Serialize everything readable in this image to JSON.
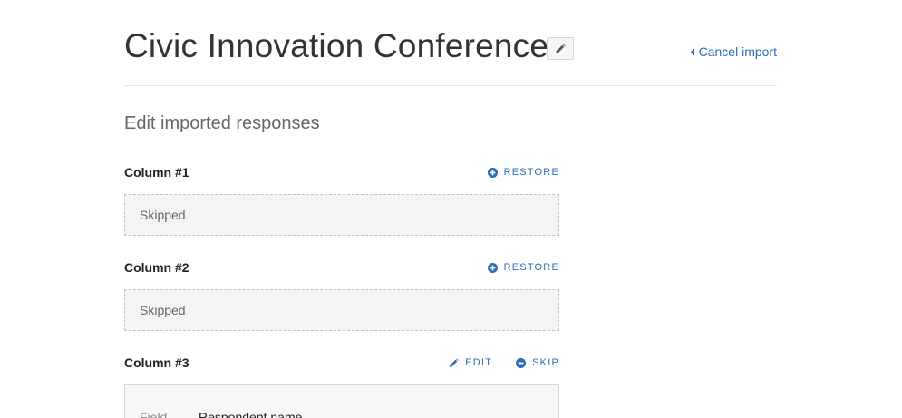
{
  "header": {
    "title": "Civic Innovation Conference",
    "edit_icon": "pencil-icon",
    "cancel_label": "Cancel import",
    "cancel_icon": "caret-left-icon"
  },
  "section": {
    "title": "Edit imported responses"
  },
  "columns": [
    {
      "label": "Column #1",
      "status": "Skipped",
      "actions": [
        {
          "label": "RESTORE",
          "icon": "plus-circle-icon"
        }
      ]
    },
    {
      "label": "Column #2",
      "status": "Skipped",
      "actions": [
        {
          "label": "RESTORE",
          "icon": "plus-circle-icon"
        }
      ]
    },
    {
      "label": "Column #3",
      "actions": [
        {
          "label": "EDIT",
          "icon": "pencil-icon"
        },
        {
          "label": "SKIP",
          "icon": "minus-circle-icon"
        }
      ],
      "field_label": "Field",
      "field_value": "Respondent name"
    }
  ],
  "colors": {
    "link": "#2b6cb6",
    "divider": "#e3e3e3",
    "skipped_bg": "#f4f4f4"
  }
}
